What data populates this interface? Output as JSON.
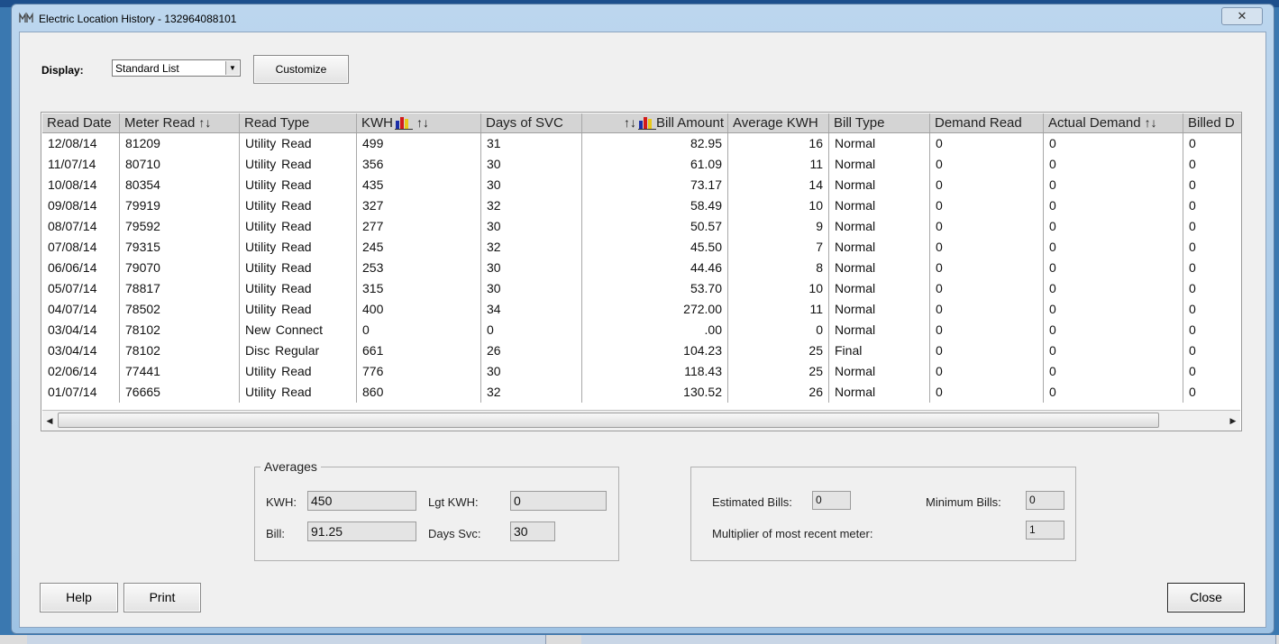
{
  "window": {
    "title": "Electric Location History - 132964088101",
    "close_glyph": "✕"
  },
  "display": {
    "label": "Display:",
    "selected": "Standard List",
    "customize_label": "Customize"
  },
  "grid": {
    "columns": [
      {
        "label": "Read Date",
        "sort": false,
        "chart": false
      },
      {
        "label": "Meter Read",
        "sort": true,
        "chart": false
      },
      {
        "label": "Read Type",
        "sort": false,
        "chart": false
      },
      {
        "label": "KWH",
        "sort": true,
        "chart": true
      },
      {
        "label": "Days of SVC",
        "sort": false,
        "chart": false
      },
      {
        "label": "Bill Amount",
        "sort": true,
        "chart": true
      },
      {
        "label": "Average KWH",
        "sort": false,
        "chart": false
      },
      {
        "label": "Bill Type",
        "sort": false,
        "chart": false
      },
      {
        "label": "Demand Read",
        "sort": false,
        "chart": false
      },
      {
        "label": "Actual Demand",
        "sort": true,
        "chart": false
      },
      {
        "label": "Billed D",
        "sort": false,
        "chart": false
      }
    ],
    "rows": [
      [
        "12/08/14",
        "81209",
        "Utility  Read",
        "499",
        "31",
        "82.95",
        "16",
        "Normal",
        "0",
        "0",
        "0"
      ],
      [
        "11/07/14",
        "80710",
        "Utility  Read",
        "356",
        "30",
        "61.09",
        "11",
        "Normal",
        "0",
        "0",
        "0"
      ],
      [
        "10/08/14",
        "80354",
        "Utility  Read",
        "435",
        "30",
        "73.17",
        "14",
        "Normal",
        "0",
        "0",
        "0"
      ],
      [
        "09/08/14",
        "79919",
        "Utility  Read",
        "327",
        "32",
        "58.49",
        "10",
        "Normal",
        "0",
        "0",
        "0"
      ],
      [
        "08/07/14",
        "79592",
        "Utility  Read",
        "277",
        "30",
        "50.57",
        "9",
        "Normal",
        "0",
        "0",
        "0"
      ],
      [
        "07/08/14",
        "79315",
        "Utility  Read",
        "245",
        "32",
        "45.50",
        "7",
        "Normal",
        "0",
        "0",
        "0"
      ],
      [
        "06/06/14",
        "79070",
        "Utility  Read",
        "253",
        "30",
        "44.46",
        "8",
        "Normal",
        "0",
        "0",
        "0"
      ],
      [
        "05/07/14",
        "78817",
        "Utility  Read",
        "315",
        "30",
        "53.70",
        "10",
        "Normal",
        "0",
        "0",
        "0"
      ],
      [
        "04/07/14",
        "78502",
        "Utility  Read",
        "400",
        "34",
        "272.00",
        "11",
        "Normal",
        "0",
        "0",
        "0"
      ],
      [
        "03/04/14",
        "78102",
        "New  Connect",
        "0",
        "0",
        ".00",
        "0",
        "Normal",
        "0",
        "0",
        "0"
      ],
      [
        "03/04/14",
        "78102",
        "Disc  Regular",
        "661",
        "26",
        "104.23",
        "25",
        "Final",
        "0",
        "0",
        "0"
      ],
      [
        "02/06/14",
        "77441",
        "Utility  Read",
        "776",
        "30",
        "118.43",
        "25",
        "Normal",
        "0",
        "0",
        "0"
      ],
      [
        "01/07/14",
        "76665",
        "Utility  Read",
        "860",
        "32",
        "130.52",
        "26",
        "Normal",
        "0",
        "0",
        "0"
      ]
    ]
  },
  "averages": {
    "legend": "Averages",
    "kwh_label": "KWH:",
    "kwh_value": "450",
    "lgt_kwh_label": "Lgt KWH:",
    "lgt_kwh_value": "0",
    "bill_label": "Bill:",
    "bill_value": "91.25",
    "days_svc_label": "Days Svc:",
    "days_svc_value": "30"
  },
  "bills": {
    "estimated_label": "Estimated Bills:",
    "estimated_value": "0",
    "minimum_label": "Minimum Bills:",
    "minimum_value": "0",
    "multiplier_label": "Multiplier of most recent meter:",
    "multiplier_value": "1"
  },
  "buttons": {
    "help": "Help",
    "print": "Print",
    "close": "Close"
  },
  "colors": {
    "window_frame": "#9fc3e4",
    "client_bg": "#f0f0f0",
    "header_bg": "#d4d4d4"
  }
}
